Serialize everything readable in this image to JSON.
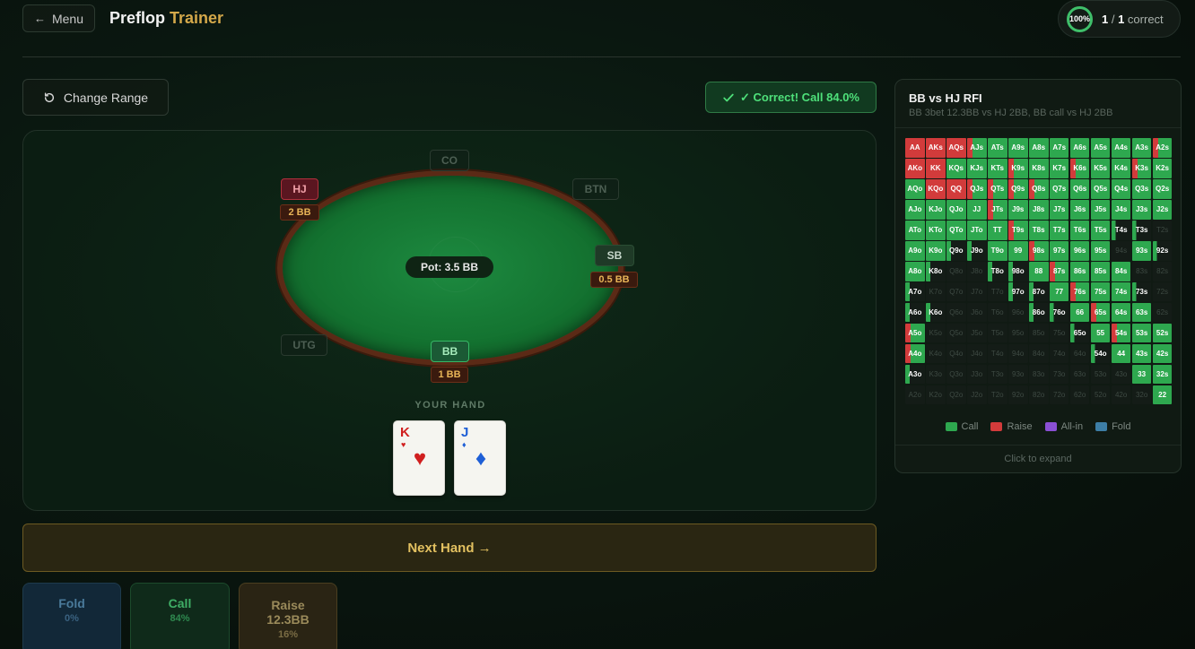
{
  "header": {
    "back_arrow": "←",
    "menu_label": "Menu",
    "title_main": "Preflop",
    "title_accent": "Trainer",
    "score_percent": "100%",
    "score_correct": "1",
    "score_sep": " / ",
    "score_total": "1",
    "score_suffix": " correct"
  },
  "toolbar": {
    "change_range_label": "Change Range",
    "feedback": "✓ Correct! Call 84.0%"
  },
  "table": {
    "pot": "Pot: 3.5 BB",
    "seats": {
      "co": {
        "label": "CO"
      },
      "btn": {
        "label": "BTN"
      },
      "hj": {
        "label": "HJ",
        "stack": "2 BB"
      },
      "sb": {
        "label": "SB",
        "stack": "0.5 BB"
      },
      "utg": {
        "label": "UTG"
      },
      "bb": {
        "label": "BB",
        "stack": "1 BB"
      }
    },
    "your_hand_label": "YOUR HAND",
    "cards": [
      {
        "rank": "K",
        "suit": "♥",
        "color": "#d01f1f"
      },
      {
        "rank": "J",
        "suit": "♦",
        "color": "#1e5fd6"
      }
    ]
  },
  "next_hand_label": "Next Hand →",
  "actions": [
    {
      "label": "Fold",
      "pct": "0%"
    },
    {
      "label": "Call",
      "pct": "84%"
    },
    {
      "label": "Raise 12.3BB",
      "pct": "16%"
    }
  ],
  "range": {
    "title": "BB vs HJ RFI",
    "subtitle": "BB 3bet 12.3BB vs HJ 2BB, BB call vs HJ 2BB",
    "ranks": [
      "A",
      "K",
      "Q",
      "J",
      "T",
      "9",
      "8",
      "7",
      "6",
      "5",
      "4",
      "3",
      "2"
    ],
    "legend": [
      {
        "label": "Call",
        "color": "#2ea84f"
      },
      {
        "label": "Raise",
        "color": "#d23b3b"
      },
      {
        "label": "All-in",
        "color": "#8a4fd4"
      },
      {
        "label": "Fold",
        "color": "#3d7ea6"
      }
    ],
    "expand_label": "Click to expand",
    "colors": {
      "call": "#2ea84f",
      "raise": "#d23b3b",
      "fold_bg": "#141c17",
      "fold_text": "#3e4a43"
    }
  }
}
